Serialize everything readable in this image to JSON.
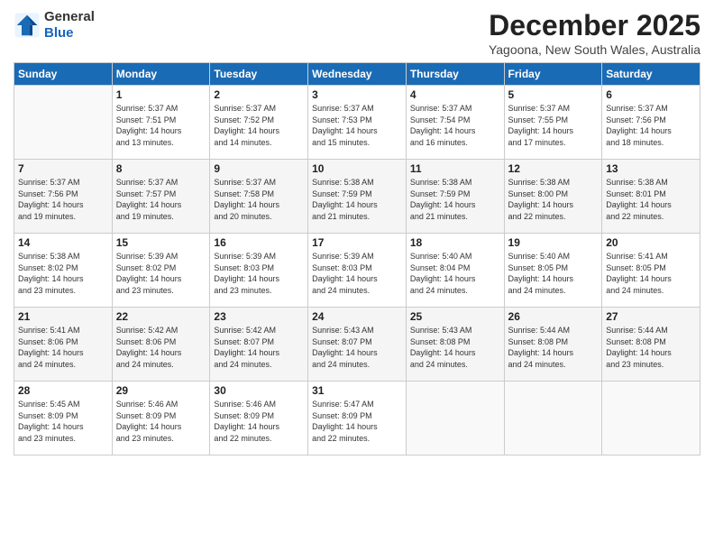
{
  "logo": {
    "general": "General",
    "blue": "Blue"
  },
  "header": {
    "month": "December 2025",
    "location": "Yagoona, New South Wales, Australia"
  },
  "weekdays": [
    "Sunday",
    "Monday",
    "Tuesday",
    "Wednesday",
    "Thursday",
    "Friday",
    "Saturday"
  ],
  "weeks": [
    [
      {
        "day": "",
        "info": ""
      },
      {
        "day": "1",
        "info": "Sunrise: 5:37 AM\nSunset: 7:51 PM\nDaylight: 14 hours\nand 13 minutes."
      },
      {
        "day": "2",
        "info": "Sunrise: 5:37 AM\nSunset: 7:52 PM\nDaylight: 14 hours\nand 14 minutes."
      },
      {
        "day": "3",
        "info": "Sunrise: 5:37 AM\nSunset: 7:53 PM\nDaylight: 14 hours\nand 15 minutes."
      },
      {
        "day": "4",
        "info": "Sunrise: 5:37 AM\nSunset: 7:54 PM\nDaylight: 14 hours\nand 16 minutes."
      },
      {
        "day": "5",
        "info": "Sunrise: 5:37 AM\nSunset: 7:55 PM\nDaylight: 14 hours\nand 17 minutes."
      },
      {
        "day": "6",
        "info": "Sunrise: 5:37 AM\nSunset: 7:56 PM\nDaylight: 14 hours\nand 18 minutes."
      }
    ],
    [
      {
        "day": "7",
        "info": "Sunrise: 5:37 AM\nSunset: 7:56 PM\nDaylight: 14 hours\nand 19 minutes."
      },
      {
        "day": "8",
        "info": "Sunrise: 5:37 AM\nSunset: 7:57 PM\nDaylight: 14 hours\nand 19 minutes."
      },
      {
        "day": "9",
        "info": "Sunrise: 5:37 AM\nSunset: 7:58 PM\nDaylight: 14 hours\nand 20 minutes."
      },
      {
        "day": "10",
        "info": "Sunrise: 5:38 AM\nSunset: 7:59 PM\nDaylight: 14 hours\nand 21 minutes."
      },
      {
        "day": "11",
        "info": "Sunrise: 5:38 AM\nSunset: 7:59 PM\nDaylight: 14 hours\nand 21 minutes."
      },
      {
        "day": "12",
        "info": "Sunrise: 5:38 AM\nSunset: 8:00 PM\nDaylight: 14 hours\nand 22 minutes."
      },
      {
        "day": "13",
        "info": "Sunrise: 5:38 AM\nSunset: 8:01 PM\nDaylight: 14 hours\nand 22 minutes."
      }
    ],
    [
      {
        "day": "14",
        "info": "Sunrise: 5:38 AM\nSunset: 8:02 PM\nDaylight: 14 hours\nand 23 minutes."
      },
      {
        "day": "15",
        "info": "Sunrise: 5:39 AM\nSunset: 8:02 PM\nDaylight: 14 hours\nand 23 minutes."
      },
      {
        "day": "16",
        "info": "Sunrise: 5:39 AM\nSunset: 8:03 PM\nDaylight: 14 hours\nand 23 minutes."
      },
      {
        "day": "17",
        "info": "Sunrise: 5:39 AM\nSunset: 8:03 PM\nDaylight: 14 hours\nand 24 minutes."
      },
      {
        "day": "18",
        "info": "Sunrise: 5:40 AM\nSunset: 8:04 PM\nDaylight: 14 hours\nand 24 minutes."
      },
      {
        "day": "19",
        "info": "Sunrise: 5:40 AM\nSunset: 8:05 PM\nDaylight: 14 hours\nand 24 minutes."
      },
      {
        "day": "20",
        "info": "Sunrise: 5:41 AM\nSunset: 8:05 PM\nDaylight: 14 hours\nand 24 minutes."
      }
    ],
    [
      {
        "day": "21",
        "info": "Sunrise: 5:41 AM\nSunset: 8:06 PM\nDaylight: 14 hours\nand 24 minutes."
      },
      {
        "day": "22",
        "info": "Sunrise: 5:42 AM\nSunset: 8:06 PM\nDaylight: 14 hours\nand 24 minutes."
      },
      {
        "day": "23",
        "info": "Sunrise: 5:42 AM\nSunset: 8:07 PM\nDaylight: 14 hours\nand 24 minutes."
      },
      {
        "day": "24",
        "info": "Sunrise: 5:43 AM\nSunset: 8:07 PM\nDaylight: 14 hours\nand 24 minutes."
      },
      {
        "day": "25",
        "info": "Sunrise: 5:43 AM\nSunset: 8:08 PM\nDaylight: 14 hours\nand 24 minutes."
      },
      {
        "day": "26",
        "info": "Sunrise: 5:44 AM\nSunset: 8:08 PM\nDaylight: 14 hours\nand 24 minutes."
      },
      {
        "day": "27",
        "info": "Sunrise: 5:44 AM\nSunset: 8:08 PM\nDaylight: 14 hours\nand 23 minutes."
      }
    ],
    [
      {
        "day": "28",
        "info": "Sunrise: 5:45 AM\nSunset: 8:09 PM\nDaylight: 14 hours\nand 23 minutes."
      },
      {
        "day": "29",
        "info": "Sunrise: 5:46 AM\nSunset: 8:09 PM\nDaylight: 14 hours\nand 23 minutes."
      },
      {
        "day": "30",
        "info": "Sunrise: 5:46 AM\nSunset: 8:09 PM\nDaylight: 14 hours\nand 22 minutes."
      },
      {
        "day": "31",
        "info": "Sunrise: 5:47 AM\nSunset: 8:09 PM\nDaylight: 14 hours\nand 22 minutes."
      },
      {
        "day": "",
        "info": ""
      },
      {
        "day": "",
        "info": ""
      },
      {
        "day": "",
        "info": ""
      }
    ]
  ]
}
